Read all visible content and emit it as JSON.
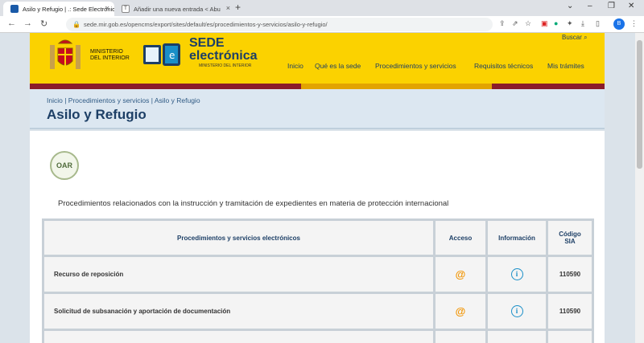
{
  "browser": {
    "tabs": [
      {
        "title": "Asilo y Refugio | .: Sede Electrónic",
        "active": true
      },
      {
        "title": "Añadir una nueva entrada < Abu",
        "active": false
      }
    ],
    "url": "sede.mir.gob.es/opencms/export/sites/default/es/procedimientos-y-servicios/asilo-y-refugio/",
    "profile_initial": "B"
  },
  "header": {
    "ministry_line1": "MINISTERIO",
    "ministry_line2": "DEL INTERIOR",
    "sede_line1": "SEDE",
    "sede_line2": "electrónica",
    "sede_sub": "MINISTERIO DEL INTERIOR",
    "buscar": "Buscar",
    "nav": [
      "Inicio",
      "Qué es la sede",
      "Procedimientos y servicios",
      "Requisitos técnicos",
      "Mis trámites"
    ]
  },
  "breadcrumb": "Inicio | Procedimientos y servicios | Asilo y Refugio",
  "page_title": "Asilo y Refugio",
  "oar_label": "OAR",
  "intro": "Procedimientos relacionados con la instrucción y tramitación de expedientes en materia de protección internacional",
  "table": {
    "headers": [
      "Procedimientos y servicios electrónicos",
      "Acceso",
      "Información",
      "Código SIA"
    ],
    "rows": [
      {
        "name": "Recurso de reposición",
        "code": "110590"
      },
      {
        "name": "Solicitud de subsanación y aportación de documentación",
        "code": "110590"
      }
    ]
  },
  "colors": {
    "header_yellow": "#fbd200",
    "brand_blue": "#1d3f66",
    "accent_orange": "#f29400",
    "info_blue": "#1a8fc8"
  }
}
